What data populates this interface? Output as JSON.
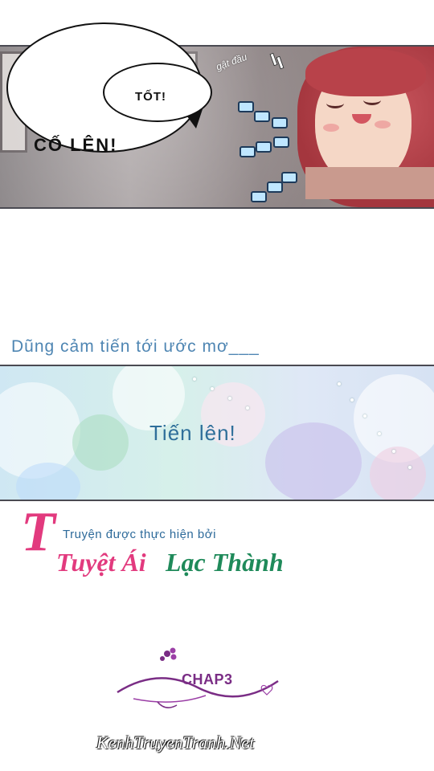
{
  "panel_1": {
    "speech_small": "TỐT!",
    "speech_large": "CỐ LÊN!",
    "sfx_nod": "gật đầu"
  },
  "narration": "Dũng cảm tiến tới ước mơ___",
  "panel_2": {
    "shout": "Tiến lên!"
  },
  "credits": {
    "big_letter": "T",
    "line": "Truyện được thực hiện bởi",
    "group_name_1": "Tuyệt Ái",
    "group_name_2": "Lạc Thành"
  },
  "chapter_label": "CHAP3",
  "footer_site": "KenhTruyenTranh.Net",
  "colors": {
    "narration": "#4f86b3",
    "credit_pink": "#e23a7e",
    "credit_green": "#1f8a5a",
    "credit_blue": "#2d6a9a",
    "chapter_purple": "#7a2d85"
  }
}
